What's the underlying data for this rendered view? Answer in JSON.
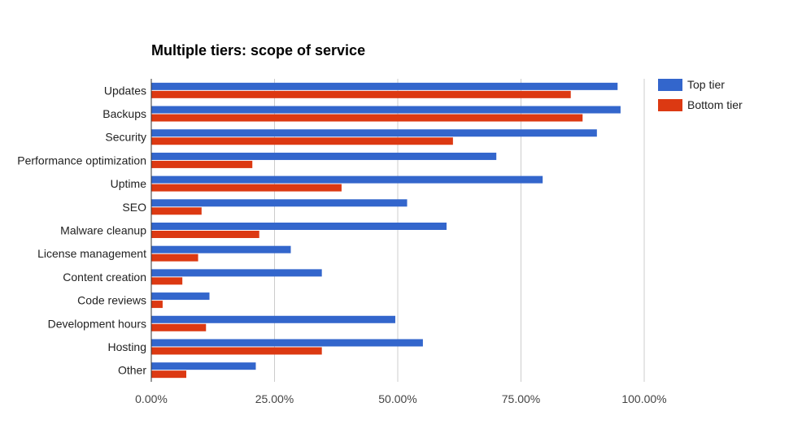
{
  "chart_data": {
    "type": "bar",
    "orientation": "horizontal",
    "title": "Multiple tiers: scope of service",
    "xlabel": "",
    "ylabel": "",
    "xlim": [
      0,
      100
    ],
    "x_ticks": [
      "0.00%",
      "25.00%",
      "50.00%",
      "75.00%",
      "100.00%"
    ],
    "x_tick_values": [
      0,
      25,
      50,
      75,
      100
    ],
    "grid": true,
    "legend_position": "right",
    "categories": [
      "Updates",
      "Backups",
      "Security",
      "Performance optimization",
      "Uptime",
      "SEO",
      "Malware cleanup",
      "License management",
      "Content creation",
      "Code reviews",
      "Development hours",
      "Hosting",
      "Other"
    ],
    "series": [
      {
        "name": "Top tier",
        "color": "#3366cc",
        "values": [
          94.6,
          95.2,
          90.4,
          70.0,
          79.4,
          51.9,
          59.9,
          28.3,
          34.6,
          11.8,
          49.5,
          55.1,
          21.2
        ]
      },
      {
        "name": "Bottom tier",
        "color": "#dc3912",
        "values": [
          85.1,
          87.5,
          61.2,
          20.5,
          38.6,
          10.2,
          21.9,
          9.5,
          6.3,
          2.3,
          11.1,
          34.6,
          7.1
        ]
      }
    ]
  }
}
